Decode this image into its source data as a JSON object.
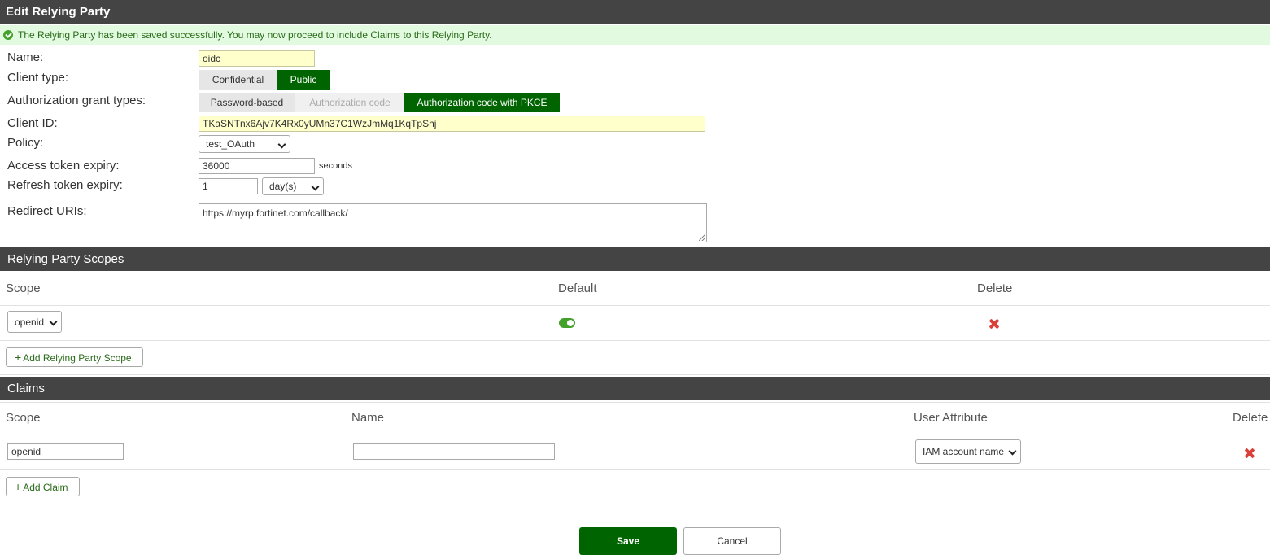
{
  "header": {
    "title": "Edit Relying Party"
  },
  "success": {
    "message": "The Relying Party has been saved successfully. You may now proceed to include Claims to this Relying Party."
  },
  "form": {
    "name_label": "Name:",
    "name_value": "oidc",
    "client_type_label": "Client type:",
    "client_type_options": [
      "Confidential",
      "Public"
    ],
    "client_type_selected": "Public",
    "grant_label": "Authorization grant types:",
    "grant_options": [
      "Password-based",
      "Authorization code",
      "Authorization code with PKCE"
    ],
    "grant_selected": "Authorization code with PKCE",
    "client_id_label": "Client ID:",
    "client_id_value": "TKaSNTnx6Ajv7K4Rx0yUMn37C1WzJmMq1KqTpShj",
    "policy_label": "Policy:",
    "policy_value": "test_OAuth",
    "access_label": "Access token expiry:",
    "access_value": "36000",
    "access_unit": "seconds",
    "refresh_label": "Refresh token expiry:",
    "refresh_value": "1",
    "refresh_unit": "day(s)",
    "redirect_label": "Redirect URIs:",
    "redirect_value": "https://myrp.fortinet.com/callback/"
  },
  "scopes": {
    "title": "Relying Party Scopes",
    "headers": [
      "Scope",
      "Default",
      "Delete"
    ],
    "rows": [
      {
        "scope": "openid",
        "default": true
      }
    ],
    "add_label": "Add Relying Party Scope"
  },
  "claims": {
    "title": "Claims",
    "headers": [
      "Scope",
      "Name",
      "User Attribute",
      "Delete"
    ],
    "rows": [
      {
        "scope": "openid",
        "name": "",
        "attribute": "IAM account name"
      }
    ],
    "add_label": "Add Claim"
  },
  "actions": {
    "save": "Save",
    "cancel": "Cancel"
  },
  "colors": {
    "accent": "#006400",
    "success_bg": "#e2fadf",
    "header_bg": "#444444",
    "delete": "#d9403a"
  }
}
